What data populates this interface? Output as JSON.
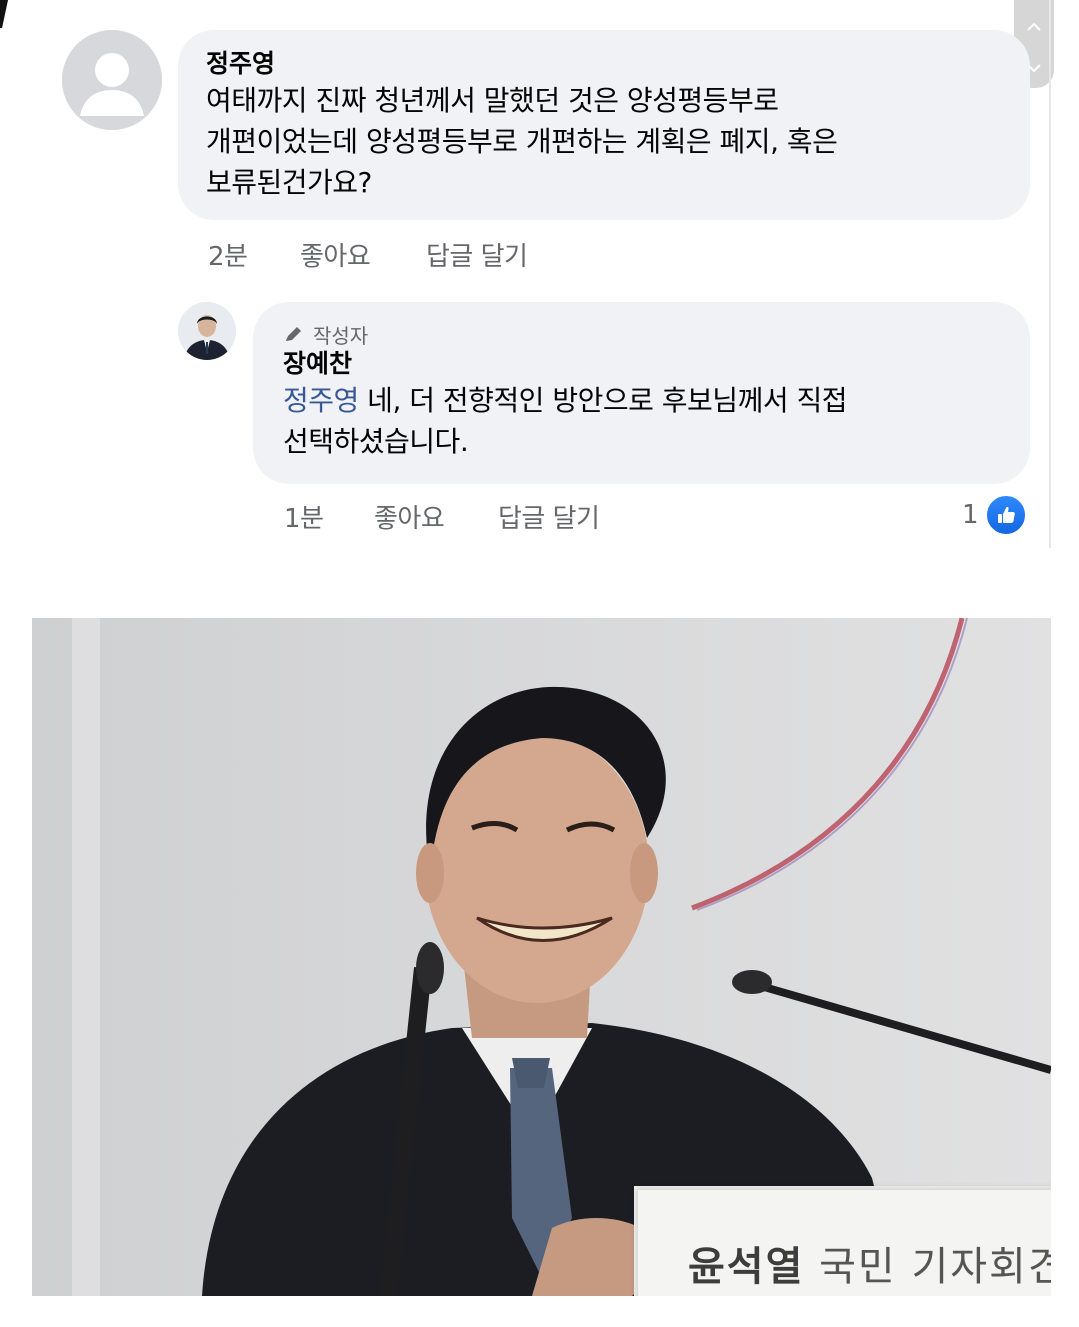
{
  "comment": {
    "author": "정주영",
    "text_lines": [
      "여태까지 진짜 청년께서 말했던 것은 양성평등부로",
      "개편이었는데 양성평등부로 개편하는 계획은 폐지, 혹은",
      "보류된건가요?"
    ],
    "time": "2분",
    "like_label": "좋아요",
    "reply_label": "답글 달기"
  },
  "reply": {
    "badge": "작성자",
    "author": "장예찬",
    "mention": "정주영",
    "text_line1": " 네, 더 전향적인 방안으로 후보님께서 직접",
    "text_line2": "선택하셨습니다.",
    "time": "1분",
    "like_label": "좋아요",
    "reply_label": "답글 달기",
    "like_count": "1"
  },
  "photo": {
    "nameplate_name": "윤석열",
    "nameplate_title": "국민 기자회견"
  },
  "colors": {
    "bubble": "#f0f2f5",
    "meta_text": "#65676b",
    "mention": "#385898",
    "like_blue": "#1877f2"
  },
  "icons": [
    "chevron-up-icon",
    "chevron-down-icon",
    "pencil-icon",
    "thumbs-up-icon",
    "default-avatar-icon"
  ]
}
